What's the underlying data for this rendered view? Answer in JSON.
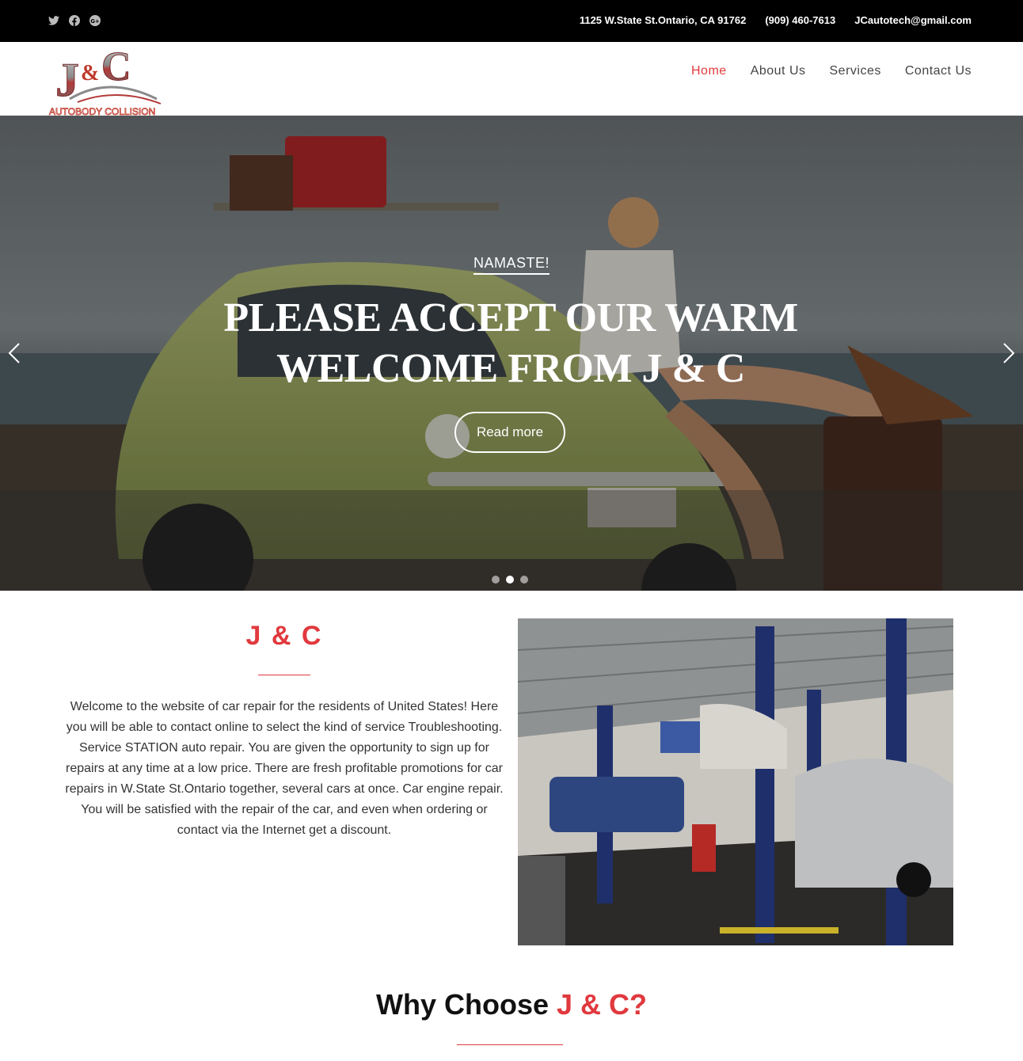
{
  "topbar": {
    "social": [
      "twitter-icon",
      "facebook-icon",
      "google-plus-icon"
    ],
    "address": "1125 W.State St.Ontario, CA 91762",
    "phone": "(909) 460-7613",
    "email": "JCautotech@gmail.com"
  },
  "logo": {
    "mark": "J&C",
    "tagline": "AUTOBODY COLLISION"
  },
  "nav": {
    "items": [
      {
        "label": "Home"
      },
      {
        "label": "About Us"
      },
      {
        "label": "Services"
      },
      {
        "label": "Contact Us"
      }
    ],
    "active_color": "#e0393e"
  },
  "hero": {
    "eyebrow": "NAMASTE!",
    "title": "PLEASE ACCEPT OUR WARM WELCOME FROM J & C",
    "button": "Read more",
    "slides_count": 3,
    "active_slide": 2
  },
  "about": {
    "title": "J & C",
    "text": "Welcome to the website of car repair for the residents of United States! Here you will be able to contact online to select the kind of service Troubleshooting. Service STATION auto repair. You are given the opportunity to sign up for repairs at any time at a low price. There are fresh profitable promotions for car repairs in W.State St.Ontario together, several cars at once. Car engine repair. You will be satisfied with the repair of the car, and even when ordering or contact via the Internet get a discount."
  },
  "why": {
    "prefix": "Why Choose ",
    "accent": "J & C?"
  },
  "colors": {
    "accent": "#e0393e",
    "topbar": "#000000"
  }
}
